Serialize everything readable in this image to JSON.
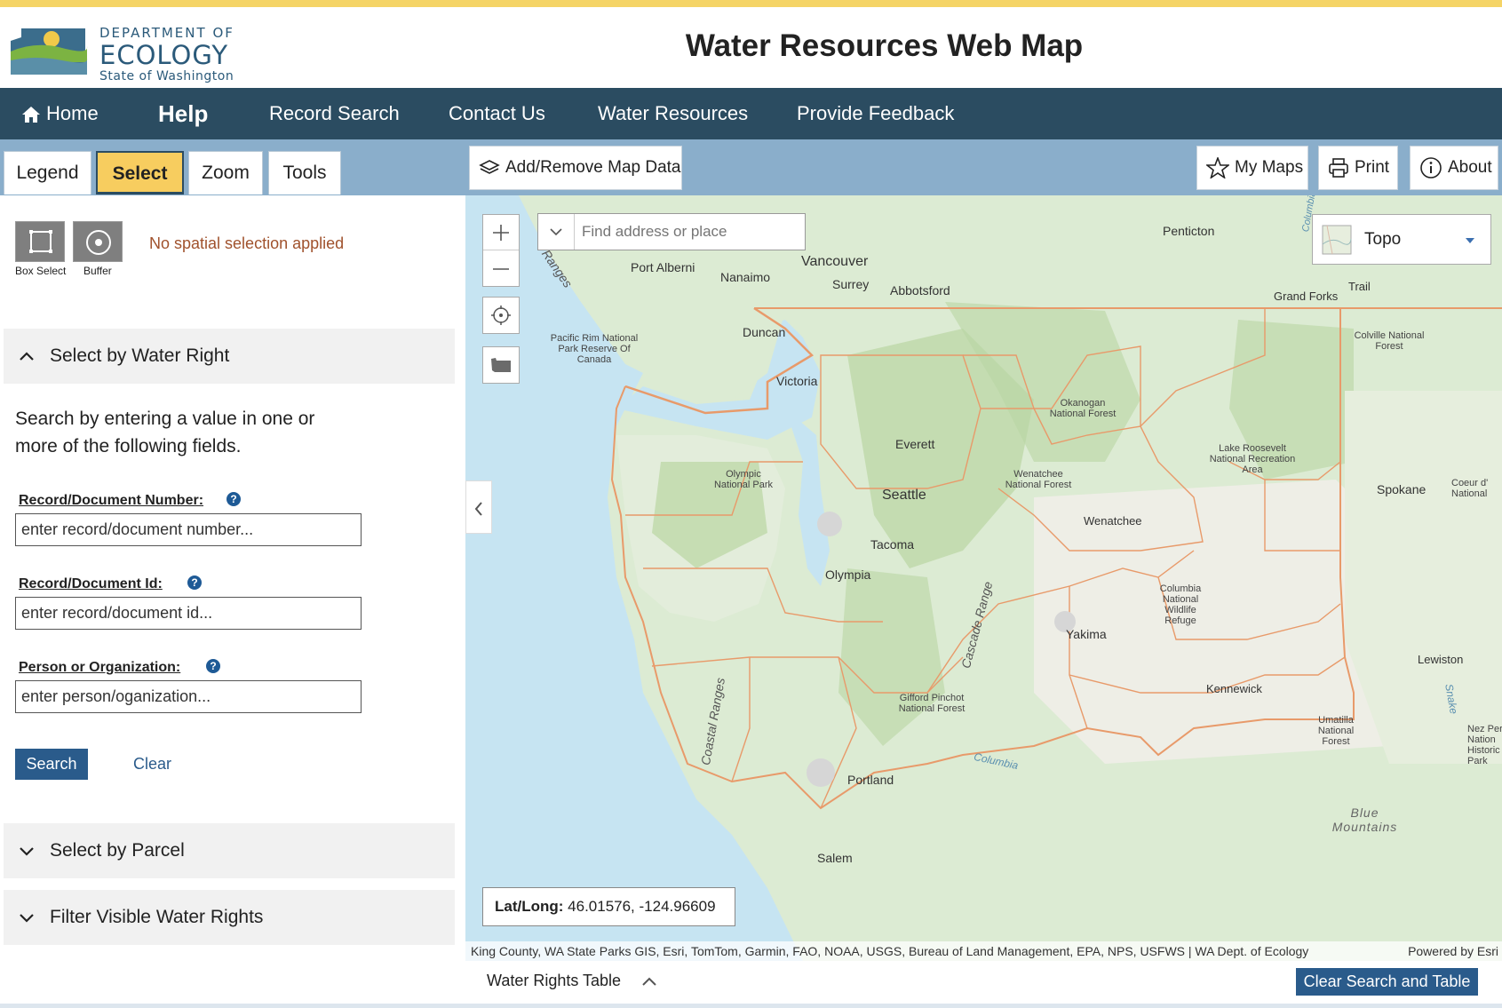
{
  "header": {
    "logo_line1": "DEPARTMENT OF",
    "logo_line2": "ECOLOGY",
    "logo_line3": "State of Washington",
    "app_title": "Water Resources Web Map"
  },
  "nav": {
    "home": "Home",
    "help": "Help",
    "record_search": "Record Search",
    "contact": "Contact Us",
    "water_resources": "Water Resources",
    "feedback": "Provide Feedback"
  },
  "tabs": {
    "legend": "Legend",
    "select": "Select",
    "zoom": "Zoom",
    "tools": "Tools"
  },
  "toolbar": {
    "add_remove": "Add/Remove Map Data",
    "my_maps": "My Maps",
    "print": "Print",
    "about": "About"
  },
  "panel": {
    "box_select": "Box Select",
    "buffer": "Buffer",
    "no_selection": "No spatial selection applied",
    "section_water_right": "Select by Water Right",
    "description": "Search by entering a value in one or more of the following fields.",
    "record_number_label": "Record/Document Number:",
    "record_number_placeholder": "enter record/document number...",
    "record_id_label": "Record/Document Id:",
    "record_id_placeholder": "enter record/document id...",
    "person_label": "Person or Organization:",
    "person_placeholder": "enter person/oganization...",
    "search": "Search",
    "clear": "Clear",
    "section_parcel": "Select by Parcel",
    "section_filter": "Filter Visible Water Rights"
  },
  "map": {
    "find_placeholder": "Find address or place",
    "basemap": "Topo",
    "latlong_label": "Lat/Long:",
    "latlong_value": "46.01576, -124.96609",
    "attribution": "King County, WA State Parks GIS, Esri, TomTom, Garmin, FAO, NOAA, USGS, Bureau of Land Management, EPA, NPS, USFWS | WA Dept. of Ecology",
    "powered_by": "Powered by Esri",
    "labels": {
      "penticton": "Penticton",
      "port_alberni": "Port Alberni",
      "nanaimo": "Nanaimo",
      "vancouver": "Vancouver",
      "surrey": "Surrey",
      "abbotsford": "Abbotsford",
      "grand_forks": "Grand Forks",
      "trail": "Trail",
      "duncan": "Duncan",
      "pacific_rim": "Pacific Rim National Park Reserve Of Canada",
      "colville": "Colville National Forest",
      "victoria": "Victoria",
      "okanogan": "Okanogan National Forest",
      "everett": "Everett",
      "olympic": "Olympic National Park",
      "wenatchee_nf": "Wenatchee National Forest",
      "lake_roosevelt": "Lake Roosevelt National Recreation Area",
      "seattle": "Seattle",
      "spokane": "Spokane",
      "coeur": "Coeur d' National",
      "wenatchee": "Wenatchee",
      "tacoma": "Tacoma",
      "olympia": "Olympia",
      "columbia_nwr": "Columbia National Wildlife Refuge",
      "yakima": "Yakima",
      "lewiston": "Lewiston",
      "kennewick": "Kennewick",
      "gifford": "Gifford Pinchot National Forest",
      "umatilla": "Umatilla National Forest",
      "nez_perce": "Nez Per Nation Historic Park",
      "portland": "Portland",
      "blue_mountains": "Blue Mountains",
      "salem": "Salem",
      "cascade_range": "Cascade Range",
      "coastal_ranges": "Coastal Ranges",
      "columbia_river": "Columbia",
      "snake": "Snake",
      "ranges_nw": "Ranges",
      "columbia_top": "Columbia"
    }
  },
  "bottom": {
    "table_label": "Water Rights Table",
    "clear_all": "Clear Search and Table"
  },
  "colors": {
    "nav_bg": "#2b4c61",
    "toolbar_bg": "#8aaecb",
    "active_tab": "#f7cd5f",
    "accent_button": "#2a5b8b",
    "stripe": "#f5d466",
    "county_lines": "#e89a6a"
  },
  "icons": [
    "home-icon",
    "layers-icon",
    "star-icon",
    "printer-icon",
    "info-icon",
    "box-select-icon",
    "buffer-icon",
    "chevron-up-icon",
    "chevron-down-icon",
    "help-icon",
    "zoom-in-icon",
    "zoom-out-icon",
    "locate-icon",
    "state-extent-icon",
    "search-dropdown-icon",
    "basemap-thumbnail-icon",
    "dropdown-arrow-icon",
    "collapse-panel-icon"
  ]
}
